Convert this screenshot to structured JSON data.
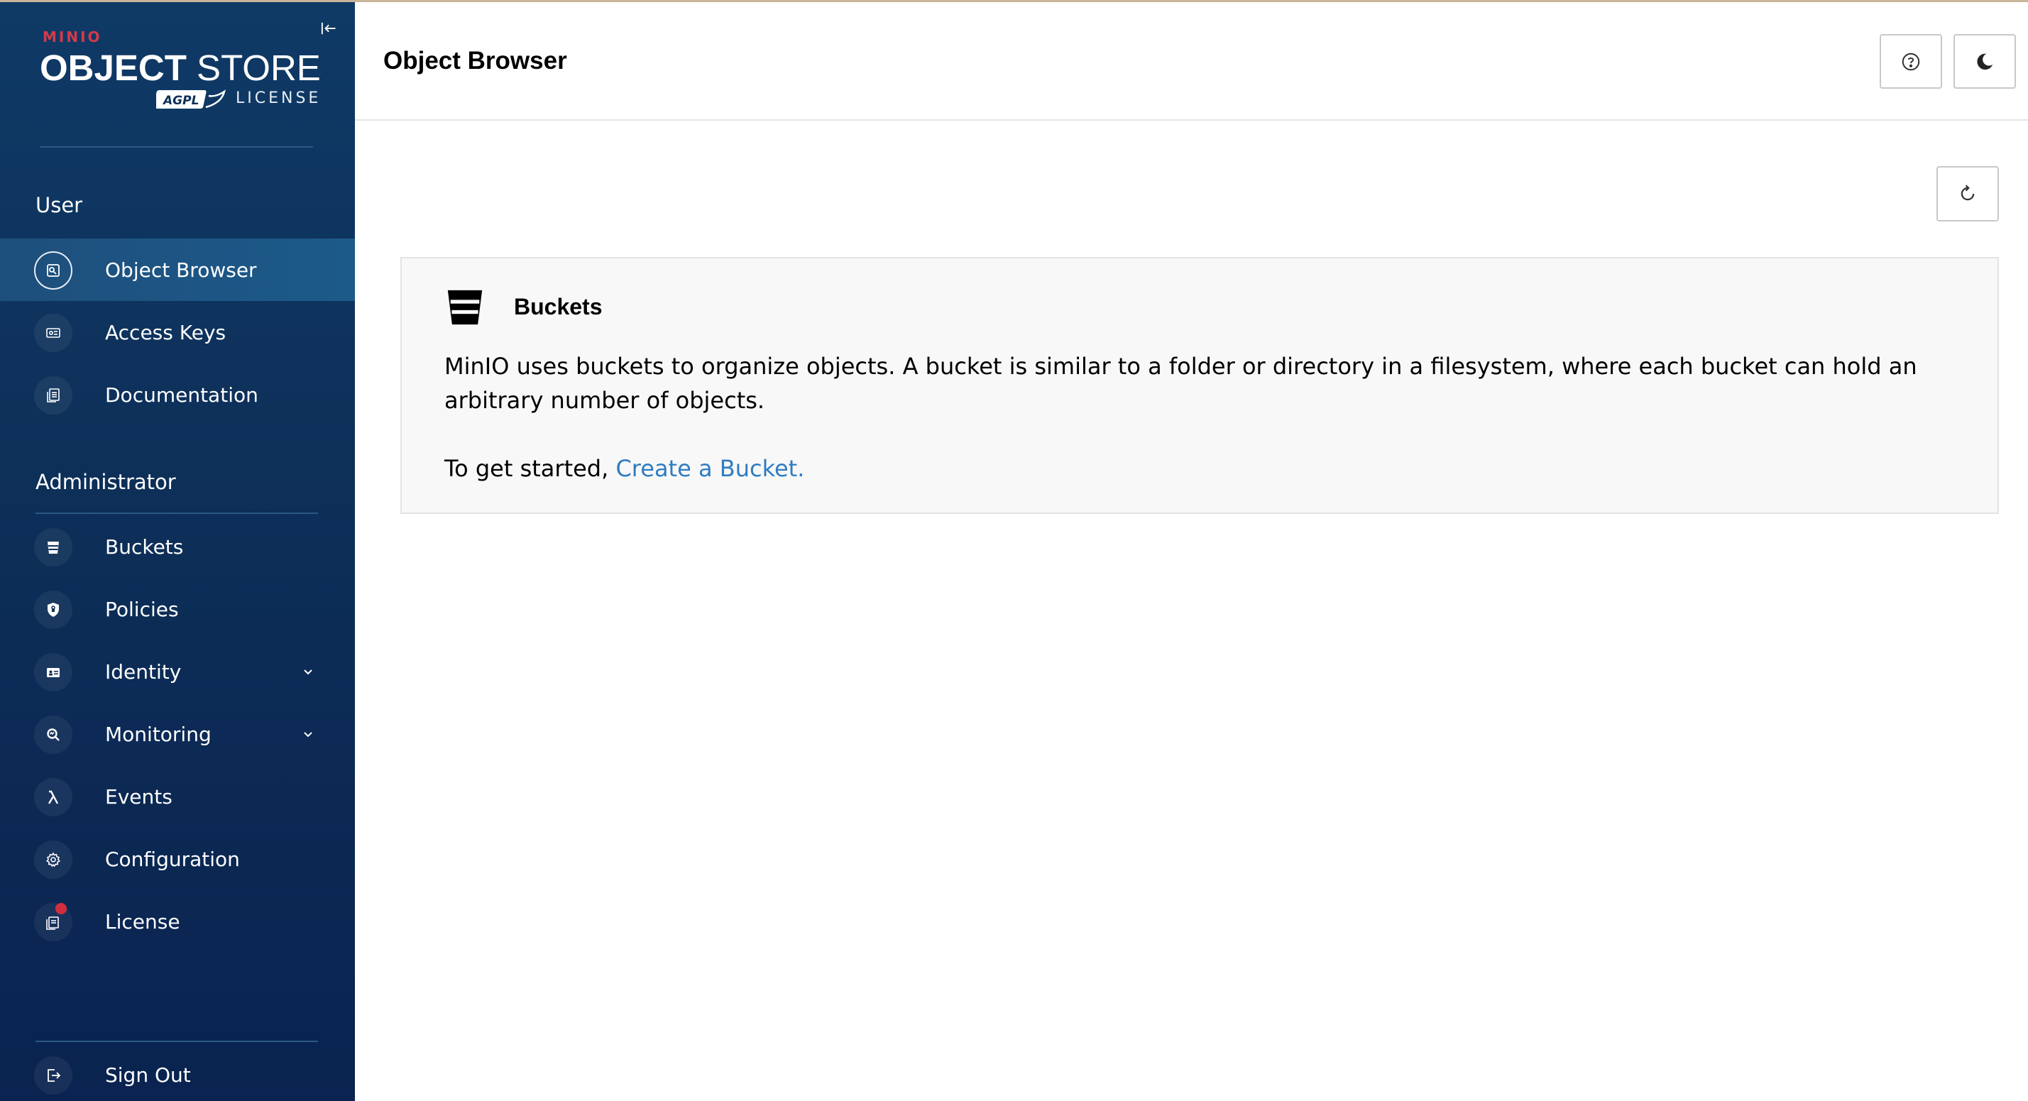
{
  "app": {
    "logo_brand": "MINIO",
    "logo_title_bold": "OBJECT",
    "logo_title_light": "STORE",
    "logo_badge": "AGPL",
    "logo_license": "LICENSE"
  },
  "sidebar": {
    "sections": [
      {
        "label": "User",
        "items": [
          {
            "label": "Object Browser",
            "icon": "object-browser-icon",
            "active": true
          },
          {
            "label": "Access Keys",
            "icon": "access-keys-icon"
          },
          {
            "label": "Documentation",
            "icon": "documentation-icon"
          }
        ]
      },
      {
        "label": "Administrator",
        "items": [
          {
            "label": "Buckets",
            "icon": "bucket-icon"
          },
          {
            "label": "Policies",
            "icon": "shield-icon"
          },
          {
            "label": "Identity",
            "icon": "identity-icon",
            "expandable": true
          },
          {
            "label": "Monitoring",
            "icon": "monitoring-icon",
            "expandable": true
          },
          {
            "label": "Events",
            "icon": "lambda-icon"
          },
          {
            "label": "Configuration",
            "icon": "gear-icon"
          },
          {
            "label": "License",
            "icon": "license-icon",
            "badge": true
          }
        ]
      }
    ],
    "sign_out": {
      "label": "Sign Out",
      "icon": "sign-out-icon"
    }
  },
  "header": {
    "title": "Object Browser",
    "help_icon": "help-icon",
    "theme_icon": "dark-mode-icon"
  },
  "main": {
    "refresh_icon": "refresh-icon",
    "info": {
      "title": "Buckets",
      "description": "MinIO uses buckets to organize objects. A bucket is similar to a folder or directory in a filesystem, where each bucket can hold an arbitrary number of objects.",
      "started_prefix": "To get started, ",
      "link_text": "Create a Bucket."
    }
  },
  "colors": {
    "sidebar_top": "#0f3a66",
    "sidebar_bottom": "#0a2350",
    "active_item": "#1c5a8a",
    "link": "#2f7cc1",
    "brand_red": "#d43a4a"
  }
}
